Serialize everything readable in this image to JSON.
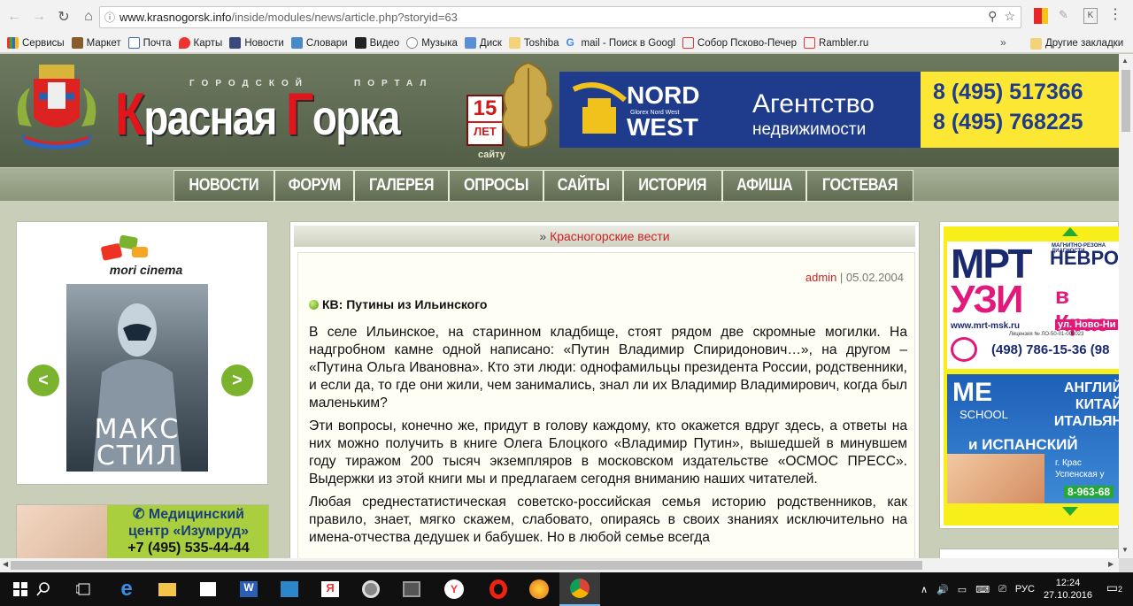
{
  "browser": {
    "url_host": "www.krasnogorsk.info",
    "url_path": "/inside/modules/news/article.php?storyid=63",
    "bookmarks": [
      "Сервисы",
      "Маркет",
      "Почта",
      "Карты",
      "Новости",
      "Словари",
      "Видео",
      "Музыка",
      "Диск",
      "Toshiba",
      "mail - Поиск в Googl",
      "Собор Псково-Печер",
      "Rambler.ru"
    ],
    "bookmarks_more": "»",
    "other_bookmarks": "Другие закладки"
  },
  "colors": {
    "accent_red": "#e0161c",
    "menu_green": "#6f7c61",
    "link_red": "#cc2222"
  },
  "header": {
    "small_left": "ГОРОДСКОЙ",
    "small_right": "ПОРТАЛ",
    "logo_k": "К",
    "logo_rest1": "расная ",
    "logo_g": "Г",
    "logo_rest2": "орка",
    "years_num": "15",
    "years_label": "ЛЕТ",
    "years_caption": "сайту",
    "banner": {
      "brand_top": "NORD",
      "brand_sub": "Glorex Nord West",
      "brand_bottom": "WEST",
      "agency_1": "Агентство",
      "agency_2": "недвижимости",
      "phone_1": "8 (495) 517366",
      "phone_2": "8 (495) 768225"
    }
  },
  "menu": [
    "НОВОСТИ",
    "ФОРУМ",
    "ГАЛЕРЕЯ",
    "ОПРОСЫ",
    "САЙТЫ",
    "ИСТОРИЯ",
    "АФИША",
    "ГОСТЕВАЯ"
  ],
  "left": {
    "cinema_name": "mori cinema",
    "poster_title": "МАКС СТИЛ",
    "prev": "<",
    "next": ">",
    "med_title_1": "Медицинский",
    "med_title_2": "центр «Изумруд»",
    "med_phone": "+7 (495) 535-44-44"
  },
  "article": {
    "crumb_prefix": "» ",
    "crumb": "Красногорские вести",
    "author": "admin",
    "sep": " | ",
    "date": "05.02.2004",
    "title": "КВ: Путины из Ильинского",
    "paragraphs": [
      "В селе Ильинское, на старинном кладбище, стоят рядом две скромные могилки. На надгробном камне одной написано: «Путин Владимир Спиридонович…», на другом – «Путина Ольга Ивановна». Кто эти люди: однофамильцы президента России, родственники, и если да, то где они жили, чем занимались, знал ли их Владимир Владимирович, когда был маленьким?",
      "Эти вопросы, конечно же, придут в голову каждому, кто окажется вдруг здесь, а ответы на них можно получить в книге Олега Блоцкого «Владимир Путин», вышедшей в минувшем году тиражом 200 тысяч экземпляров в московском издательстве «ОСМОС ПРЕСС». Выдержки из этой книги мы и предлагаем сегодня вниманию наших читателей.",
      "Любая среднестатистическая советско-российская семья историю родственников, как правило, знает, мягко скажем, слабовато, опираясь в своих знаниях исключительно на имена-отчества дедушек и бабушек. Но в любой семье всегда"
    ]
  },
  "right": {
    "mrt": "МРТ",
    "uzi": "УЗИ",
    "nevro": "НЕВРО",
    "diag": "МАГНИТНО-РЕЗОНА ДИАГНОСТИ",
    "v_kras": "в Крас",
    "site": "www.mrt-msk.ru",
    "street": "ул. Ново-Ни",
    "license": "Лицензия № ЛО-50-01-008023",
    "phone": "(498) 786-15-36",
    "phone_tail": "(98",
    "me": "ME",
    "school": "SCHOOL",
    "lang_1": "АНГЛИЙ",
    "lang_2": "КИТАЙ",
    "lang_3": "ИТАЛЬЯН",
    "lang_4": "и ИСПАНСКИЙ",
    "addr_1": "г. Крас",
    "addr_2": "Успенская у",
    "me_phone": "8-963-68"
  },
  "taskbar": {
    "lang": "РУС",
    "time": "12:24",
    "date": "27.10.2016",
    "notif_count": "2"
  }
}
